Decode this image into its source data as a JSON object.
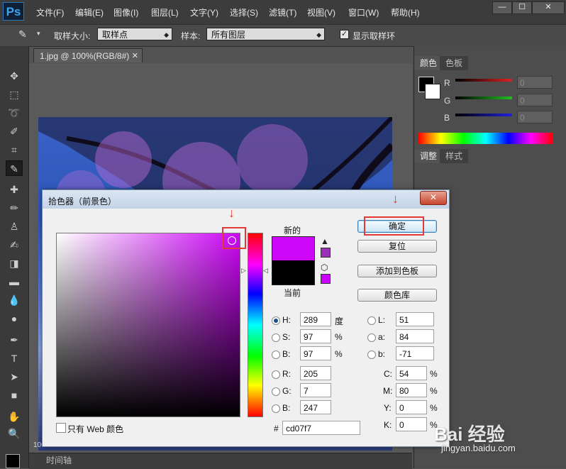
{
  "app": {
    "logo": "Ps",
    "menu": [
      "文件(F)",
      "编辑(E)",
      "图像(I)",
      "图层(L)",
      "文字(Y)",
      "选择(S)",
      "滤镜(T)",
      "视图(V)",
      "窗口(W)",
      "帮助(H)"
    ],
    "window_buttons": [
      "—",
      "☐",
      "✕"
    ]
  },
  "options_bar": {
    "sample_size_label": "取样大小:",
    "sample_size_value": "取样点",
    "sample_label": "样本:",
    "sample_value": "所有图层",
    "show_ring_label": "显示取样环",
    "show_ring_checked": true
  },
  "document": {
    "tab_title": "1.jpg @ 100%(RGB/8#)",
    "zoom": "100",
    "timeline_label": "时间轴"
  },
  "right_panel": {
    "color_tabs": [
      "颜色",
      "色板"
    ],
    "sliders": [
      {
        "label": "R",
        "value": "0",
        "color": "#e02020"
      },
      {
        "label": "G",
        "value": "0",
        "color": "#20c020"
      },
      {
        "label": "B",
        "value": "0",
        "color": "#2020e0"
      }
    ],
    "adjust_tabs": [
      "调整",
      "样式"
    ]
  },
  "dialog": {
    "title": "拾色器（前景色）",
    "new_label": "新的",
    "current_label": "当前",
    "new_color": "#cd07f7",
    "current_color": "#000000",
    "buttons": {
      "ok": "确定",
      "reset": "复位",
      "add_swatch": "添加到色板",
      "color_library": "颜色库"
    },
    "hsb": [
      {
        "label": "H:",
        "value": "289",
        "unit": "度",
        "selected": true
      },
      {
        "label": "S:",
        "value": "97",
        "unit": "%",
        "selected": false
      },
      {
        "label": "B:",
        "value": "97",
        "unit": "%",
        "selected": false
      }
    ],
    "rgb": [
      {
        "label": "R:",
        "value": "205"
      },
      {
        "label": "G:",
        "value": "7"
      },
      {
        "label": "B:",
        "value": "247"
      }
    ],
    "lab": [
      {
        "label": "L:",
        "value": "51"
      },
      {
        "label": "a:",
        "value": "84"
      },
      {
        "label": "b:",
        "value": "-71"
      }
    ],
    "cmyk": [
      {
        "label": "C:",
        "value": "54",
        "unit": "%"
      },
      {
        "label": "M:",
        "value": "80",
        "unit": "%"
      },
      {
        "label": "Y:",
        "value": "0",
        "unit": "%"
      },
      {
        "label": "K:",
        "value": "0",
        "unit": "%"
      }
    ],
    "hex_label": "#",
    "hex_value": "cd07f7",
    "web_only_label": "只有 Web 颜色"
  },
  "watermark": {
    "line1": "Bai 经验",
    "line2": "jingyan.baidu.com"
  }
}
